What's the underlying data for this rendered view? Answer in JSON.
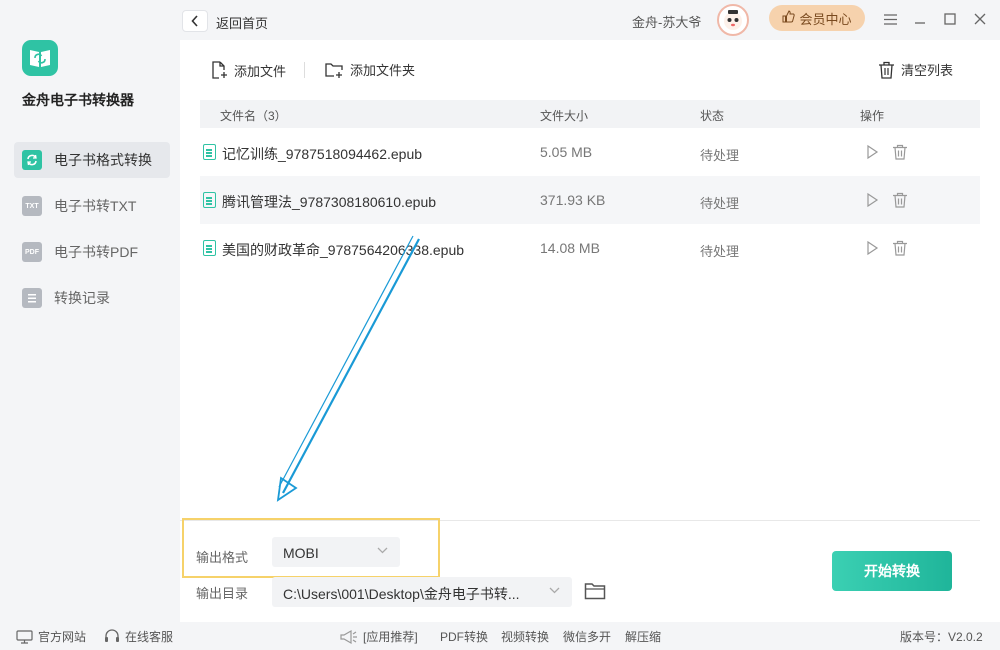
{
  "app": {
    "name": "金舟电子书转换器"
  },
  "sidebar": {
    "items": [
      {
        "icon": "refresh-icon",
        "label": "电子书格式转换",
        "active": true
      },
      {
        "icon": "txt-icon",
        "icon_text": "TXT",
        "label": "电子书转TXT",
        "active": false
      },
      {
        "icon": "pdf-icon",
        "icon_text": "PDF",
        "label": "电子书转PDF",
        "active": false
      },
      {
        "icon": "record-icon",
        "label": "转换记录",
        "active": false
      }
    ]
  },
  "topbar": {
    "back_label": "返回首页",
    "username": "金舟-苏大爷",
    "vip_label": "会员中心"
  },
  "toolbar": {
    "add_file": "添加文件",
    "add_folder": "添加文件夹",
    "clear_list": "清空列表"
  },
  "table": {
    "headers": {
      "name": "文件名（3）",
      "size": "文件大小",
      "status": "状态",
      "actions": "操作"
    },
    "rows": [
      {
        "name": "记忆训练_9787518094462.epub",
        "size": "5.05 MB",
        "status": "待处理"
      },
      {
        "name": "腾讯管理法_9787308180610.epub",
        "size": "371.93 KB",
        "status": "待处理"
      },
      {
        "name": "美国的财政革命_9787564206338.epub",
        "size": "14.08 MB",
        "status": "待处理"
      }
    ]
  },
  "output": {
    "format_label": "输出格式",
    "format_value": "MOBI",
    "dir_label": "输出目录",
    "dir_value": "C:\\Users\\001\\Desktop\\金舟电子书转..."
  },
  "start_button": "开始转换",
  "footer": {
    "website": "官方网站",
    "support": "在线客服",
    "app_recommend": "[应用推荐]",
    "links": [
      "PDF转换",
      "视频转换",
      "微信多开",
      "解压缩"
    ],
    "version": "版本号：V2.0.2"
  },
  "colors": {
    "accent": "#2fc3a4",
    "vip": "#f6d2ad",
    "highlight": "#f6d26a",
    "arrow": "#1a9ad6"
  }
}
